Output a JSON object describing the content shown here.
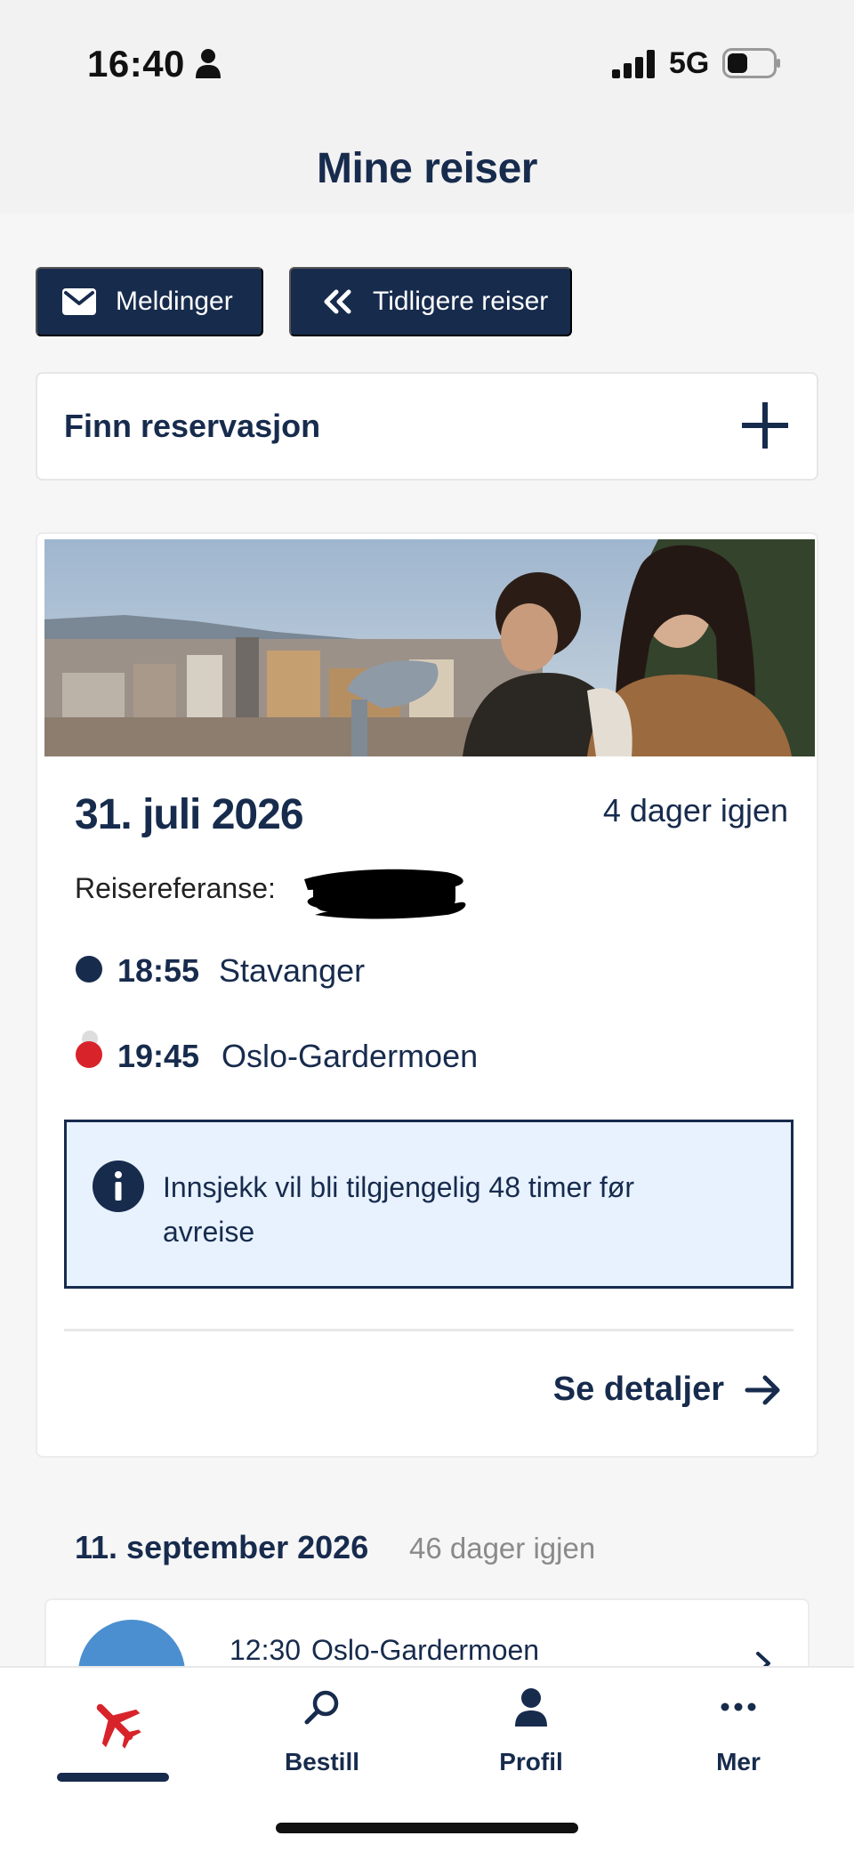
{
  "status_bar": {
    "time": "16:40",
    "network": "5G",
    "icons": [
      "person-icon",
      "signal-icon",
      "battery-icon"
    ]
  },
  "header": {
    "title": "Mine reiser"
  },
  "actions": {
    "messages_label": "Meldinger",
    "messages_icon": "envelope-icon",
    "previous_trips_label": "Tidligere reiser",
    "previous_trips_icon": "double-chevron-left-icon"
  },
  "find_reservation": {
    "label": "Finn reservasjon",
    "icon": "plus-icon"
  },
  "trips": [
    {
      "date": "31. juli 2026",
      "countdown": "4 dager igjen",
      "reference_label": "Reisereferanse:",
      "departure": {
        "time": "18:55",
        "city": "Stavanger"
      },
      "arrival": {
        "time": "19:45",
        "city": "Oslo-Gardermoen"
      },
      "info_message": "Innsjekk vil bli tilgjengelig 48 timer før avreise",
      "details_label": "Se detaljer"
    },
    {
      "date": "11. september 2026",
      "countdown": "46 dager igjen",
      "departure": {
        "time": "12:30",
        "city": "Oslo-Gardermoen"
      }
    }
  ],
  "bottom_nav": {
    "items": [
      {
        "label": "",
        "icon": "airplane-icon",
        "active": true
      },
      {
        "label": "Bestill",
        "icon": "search-icon",
        "active": false
      },
      {
        "label": "Profil",
        "icon": "person-icon",
        "active": false
      },
      {
        "label": "Mer",
        "icon": "more-dots-icon",
        "active": false
      }
    ]
  },
  "colors": {
    "navy": "#172b4d",
    "accent_red": "#d8232a",
    "info_background": "#e8f2ff",
    "page_background": "#f6f6f6"
  }
}
